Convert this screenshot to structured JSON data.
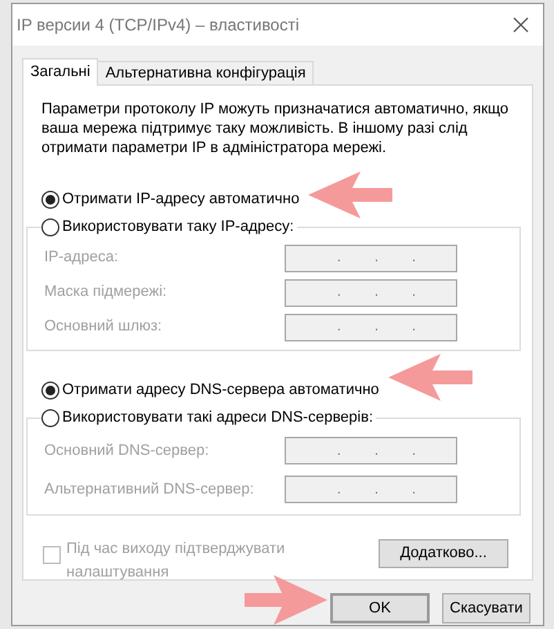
{
  "window": {
    "title": "IP версии 4 (TCP/IPv4) – властивості"
  },
  "tabs": [
    {
      "label": "Загальні",
      "selected": true
    },
    {
      "label": "Альтернативна конфігурація",
      "selected": false
    }
  ],
  "description": "Параметри протоколу IP можуть призначатися автоматично, якщо ваша мережа підтримує таку можливість. В іншому разі слід отримати параметри IP в адміністратора мережі.",
  "ip_options": [
    {
      "label": "Отримати IP-адресу автоматично",
      "selected": true
    },
    {
      "label": "Використовувати таку IP-адресу:",
      "selected": false
    }
  ],
  "ip_fields": [
    {
      "label": "IP-адреса:",
      "disabled": true,
      "separators": [
        ".",
        ".",
        "."
      ]
    },
    {
      "label": "Маска підмережі:",
      "disabled": true,
      "separators": [
        ".",
        ".",
        "."
      ]
    },
    {
      "label": "Основний шлюз:",
      "disabled": true,
      "separators": [
        ".",
        ".",
        "."
      ]
    }
  ],
  "dns_options": [
    {
      "label": "Отримати адресу DNS-сервера автоматично",
      "selected": true
    },
    {
      "label": "Використовувати такі адреси DNS-серверів:",
      "selected": false
    }
  ],
  "dns_fields": [
    {
      "label": "Основний DNS-сервер:",
      "disabled": true,
      "separators": [
        ".",
        ".",
        "."
      ]
    },
    {
      "label": "Альтернативний DNS-сервер:",
      "disabled": true,
      "separators": [
        ".",
        ".",
        "."
      ]
    }
  ],
  "validate": {
    "label": "Під час виходу підтверджувати налаштування",
    "checked": false,
    "disabled": true
  },
  "advanced_button": "Додатково...",
  "buttons": [
    {
      "label": "OK",
      "default": true
    },
    {
      "label": "Скасувати",
      "default": false
    }
  ]
}
